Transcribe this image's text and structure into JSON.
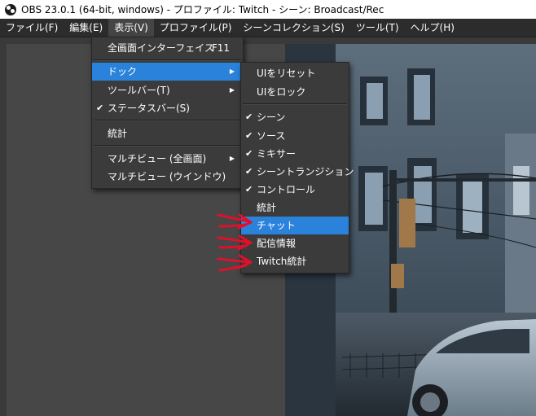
{
  "window": {
    "title": "OBS 23.0.1 (64-bit, windows) - プロファイル: Twitch - シーン: Broadcast/Rec"
  },
  "menubar": {
    "items": [
      {
        "label": "ファイル(F)"
      },
      {
        "label": "編集(E)"
      },
      {
        "label": "表示(V)"
      },
      {
        "label": "プロファイル(P)"
      },
      {
        "label": "シーンコレクション(S)"
      },
      {
        "label": "ツール(T)"
      },
      {
        "label": "ヘルプ(H)"
      }
    ]
  },
  "view_menu": {
    "items": [
      {
        "label": "全画面インターフェイス",
        "shortcut": "F11"
      },
      {
        "label": "ドック"
      },
      {
        "label": "ツールバー(T)"
      },
      {
        "label": "ステータスバー(S)",
        "checked": true
      },
      {
        "label": "統計"
      },
      {
        "label": "マルチビュー (全画面)"
      },
      {
        "label": "マルチビュー (ウインドウ)"
      }
    ]
  },
  "dock_menu": {
    "items": [
      {
        "label": "UIをリセット"
      },
      {
        "label": "UIをロック"
      },
      {
        "label": "シーン",
        "checked": true
      },
      {
        "label": "ソース",
        "checked": true
      },
      {
        "label": "ミキサー",
        "checked": true
      },
      {
        "label": "シーントランジション",
        "checked": true
      },
      {
        "label": "コントロール",
        "checked": true
      },
      {
        "label": "統計"
      },
      {
        "label": "チャット"
      },
      {
        "label": "配信情報"
      },
      {
        "label": "Twitch統計"
      }
    ]
  },
  "colors": {
    "highlight": "#2a82da",
    "annotation": "#e0102a"
  }
}
